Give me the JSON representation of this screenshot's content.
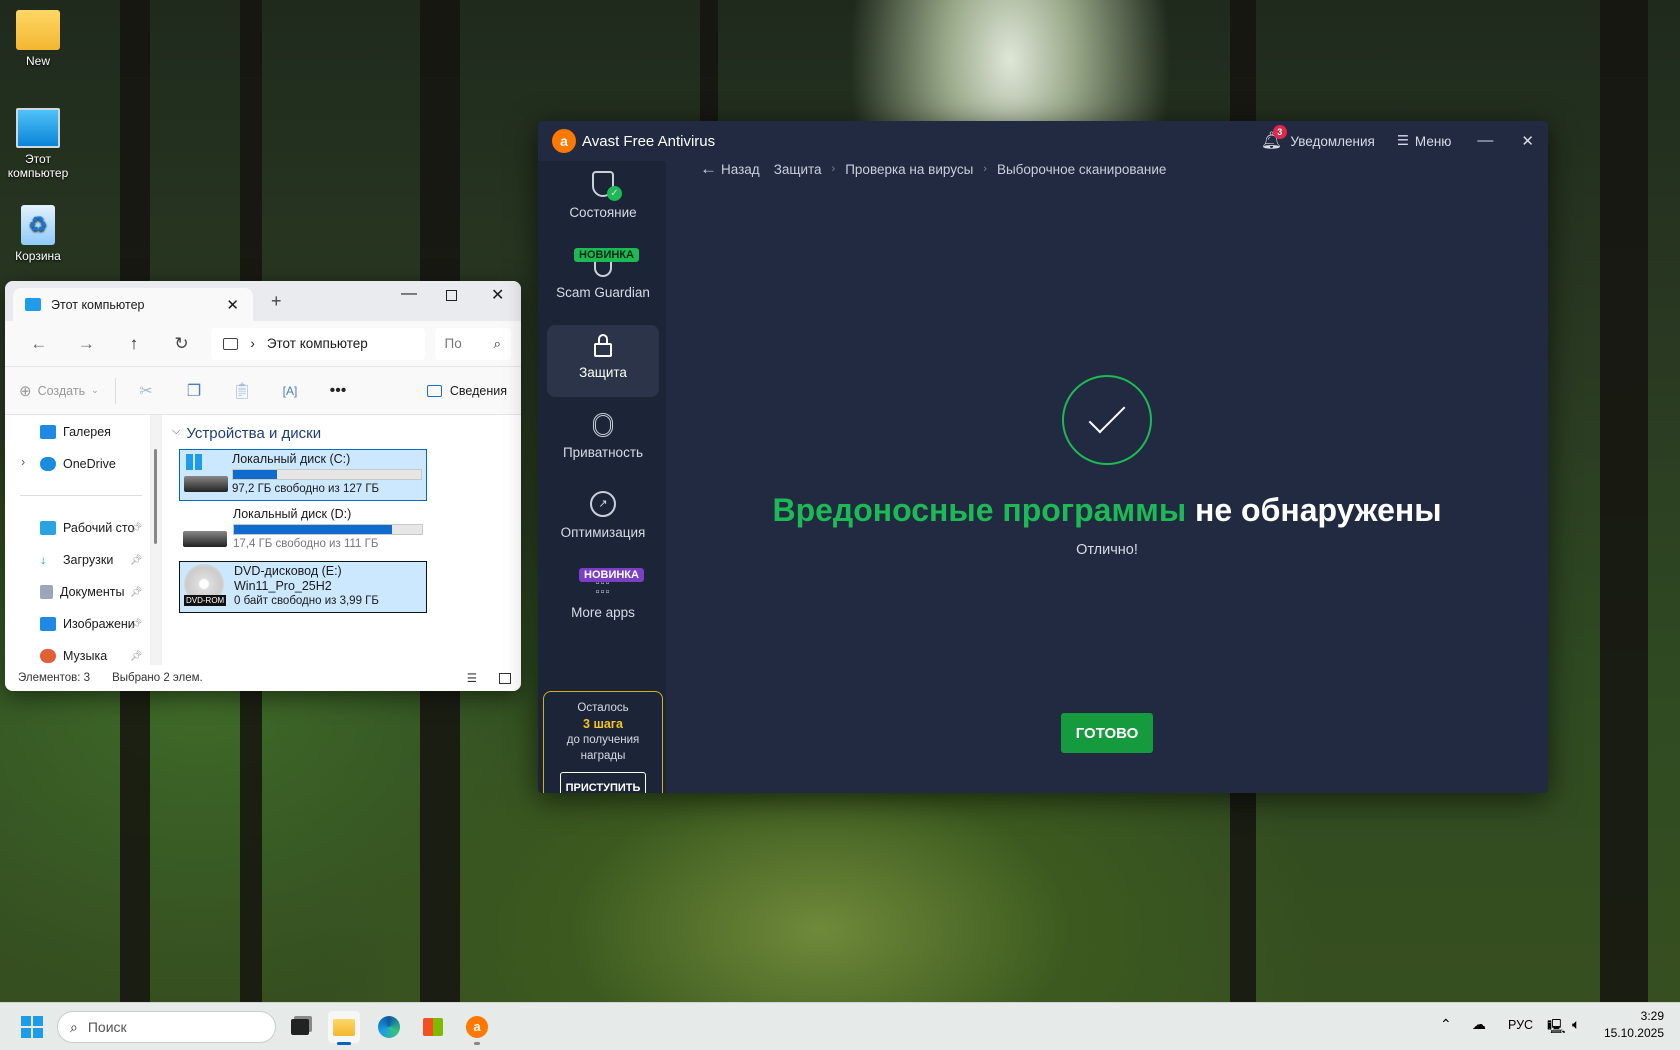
{
  "desktop": {
    "icons": [
      {
        "label": "New"
      },
      {
        "label": "Этот компьютер"
      },
      {
        "label": "Корзина"
      }
    ]
  },
  "explorer": {
    "tab_title": "Этот компьютер",
    "address": "Этот компьютер",
    "search_placeholder": "По",
    "toolbar": {
      "create": "Создать",
      "details": "Сведения"
    },
    "nav": [
      {
        "label": "Галерея"
      },
      {
        "label": "OneDrive"
      },
      {
        "label": "Рабочий сто"
      },
      {
        "label": "Загрузки"
      },
      {
        "label": "Документы"
      },
      {
        "label": "Изображени"
      },
      {
        "label": "Музыка"
      }
    ],
    "section": "Устройства и диски",
    "drives": [
      {
        "name": "Локальный диск (C:)",
        "info": "97,2 ГБ свободно из 127 ГБ",
        "used_pct": 23.5
      },
      {
        "name": "Локальный диск (D:)",
        "info": "17,4 ГБ свободно из 111 ГБ",
        "used_pct": 84.3
      },
      {
        "name": "DVD-дисковод (E:)",
        "label": "Win11_Pro_25H2",
        "info": "0 байт свободно из 3,99 ГБ",
        "badge": "DVD-ROM"
      }
    ],
    "status": {
      "count": "Элементов: 3",
      "selected": "Выбрано 2 элем."
    }
  },
  "avast": {
    "title": "Avast Free Antivirus",
    "notifications_label": "Уведомления",
    "notifications_count": "3",
    "menu_label": "Меню",
    "sidebar": [
      {
        "label": "Состояние"
      },
      {
        "label": "Scam Guardian",
        "badge": "НОВИНКА"
      },
      {
        "label": "Защита"
      },
      {
        "label": "Приватность"
      },
      {
        "label": "Оптимизация"
      },
      {
        "label": "More apps",
        "badge": "НОВИНКА"
      }
    ],
    "promo": {
      "line1": "Осталось",
      "highlight": "3 шага",
      "line2": "до получения",
      "line3": "награды",
      "button": "ПРИСТУПИТЬ"
    },
    "breadcrumb": {
      "back": "Назад",
      "items": [
        "Защита",
        "Проверка на вирусы",
        "Выборочное сканирование"
      ]
    },
    "result": {
      "highlight": "Вредоносные программы",
      "rest": " не обнаружены",
      "sub": "Отлично!"
    },
    "done_button": "ГОТОВО",
    "colors": {
      "green": "#1db954",
      "bg": "#212a40",
      "purple": "#7b3fc4"
    }
  },
  "taskbar": {
    "search_placeholder": "Поиск",
    "lang": "РУС",
    "time": "3:29",
    "date": "15.10.2025"
  }
}
